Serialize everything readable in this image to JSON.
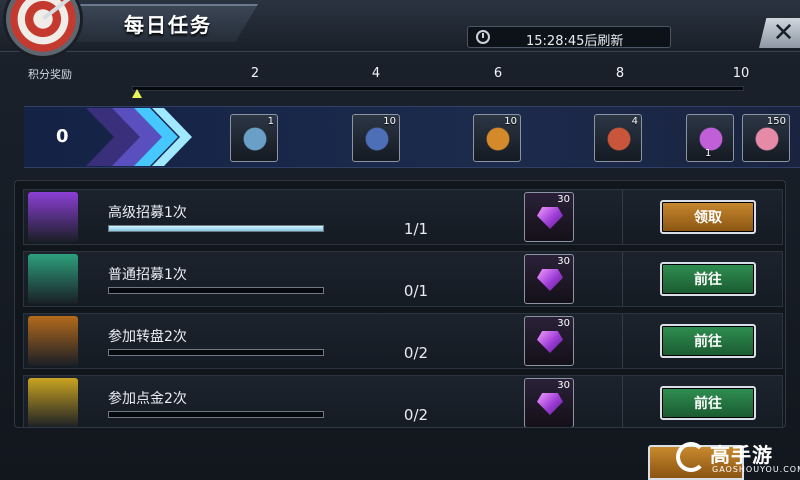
{
  "window": {
    "title": "每日任务",
    "refresh_timer": "15:28:45后刷新",
    "close_label": "✕"
  },
  "points": {
    "label": "积分奖励",
    "current": "0",
    "progress_fraction": 0.0,
    "ticks": [
      "2",
      "4",
      "6",
      "8",
      "10"
    ]
  },
  "milestone_rewards": [
    {
      "icon": "chip-icon",
      "count": "1"
    },
    {
      "icon": "ticket-icon",
      "count": "10"
    },
    {
      "icon": "bullet-icon",
      "count": "10"
    },
    {
      "icon": "roulette-chip-icon",
      "count": "4"
    },
    {
      "icon": "avatar-frame-icon",
      "count": "1"
    },
    {
      "icon": "card-pack-icon",
      "count": "150"
    }
  ],
  "tasks": [
    {
      "name": "高级招募1次",
      "progress": "1/1",
      "fill": 1.0,
      "reward_count": "30",
      "button": "领取",
      "button_type": "claim",
      "icon": "premium-recruit-icon",
      "icon_color": "#8c3fd6"
    },
    {
      "name": "普通招募1次",
      "progress": "0/1",
      "fill": 0.0,
      "reward_count": "30",
      "button": "前往",
      "button_type": "go",
      "icon": "normal-recruit-icon",
      "icon_color": "#2d9f7c"
    },
    {
      "name": "参加转盘2次",
      "progress": "0/2",
      "fill": 0.0,
      "reward_count": "30",
      "button": "前往",
      "button_type": "go",
      "icon": "slot-777-icon",
      "icon_color": "#b46a1c"
    },
    {
      "name": "参加点金2次",
      "progress": "0/2",
      "fill": 0.0,
      "reward_count": "30",
      "button": "前往",
      "button_type": "go",
      "icon": "gold-diamond-icon",
      "icon_color": "#c9a320"
    }
  ],
  "watermark": {
    "text": "高手游",
    "sub": "GAOSHOUYOU.COM"
  }
}
